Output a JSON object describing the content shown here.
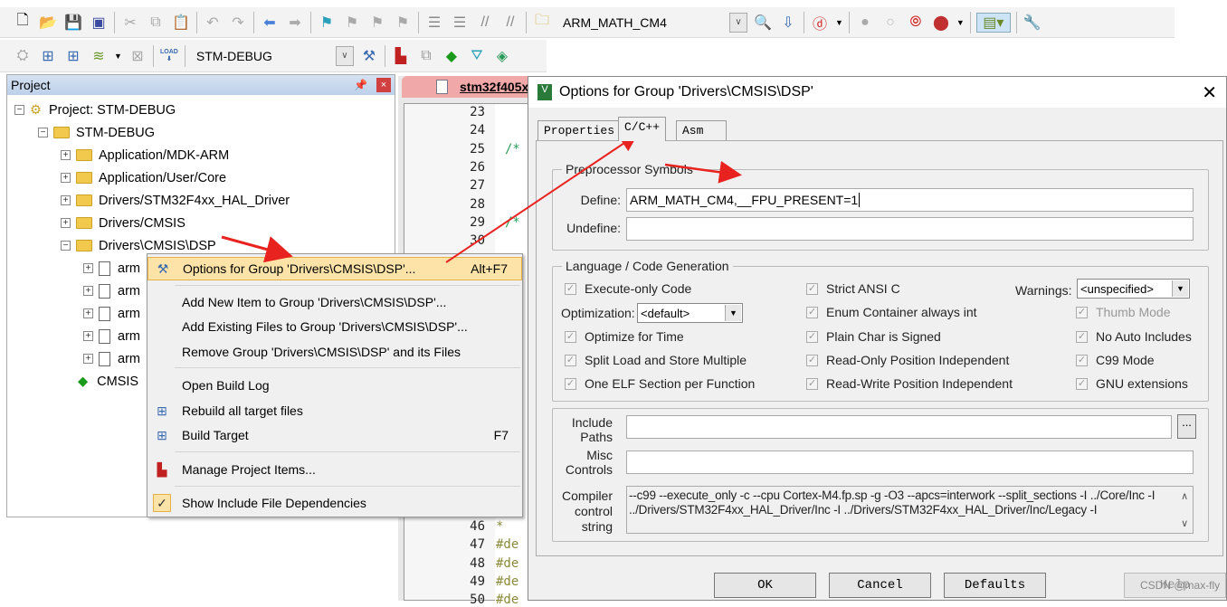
{
  "toolbar1": {
    "target_combo": "ARM_MATH_CM4"
  },
  "toolbar2": {
    "target_combo": "STM-DEBUG",
    "load_label": "LOAD"
  },
  "project_panel": {
    "title": "Project",
    "tree": [
      {
        "label": "Project: STM-DEBUG"
      },
      {
        "label": "STM-DEBUG"
      },
      {
        "label": "Application/MDK-ARM"
      },
      {
        "label": "Application/User/Core"
      },
      {
        "label": "Drivers/STM32F4xx_HAL_Driver"
      },
      {
        "label": "Drivers/CMSIS"
      },
      {
        "label": "Drivers\\CMSIS\\DSP"
      },
      {
        "label": "arm"
      },
      {
        "label": "arm"
      },
      {
        "label": "arm"
      },
      {
        "label": "arm"
      },
      {
        "label": "arm"
      },
      {
        "label": "CMSIS"
      }
    ]
  },
  "editor": {
    "tab": "stm32f405x",
    "lines_top": [
      "23",
      "24",
      "25",
      "26",
      "27",
      "28",
      "29",
      "30"
    ],
    "lines_bottom": [
      "46",
      "47",
      "48",
      "49",
      "50"
    ],
    "code_bottom": [
      "*",
      "#de",
      "#de",
      "#de",
      "#de"
    ],
    "code_top": {
      "25": "/*",
      "29": "/*"
    }
  },
  "context_menu": {
    "items": [
      {
        "label": "Options for Group 'Drivers\\CMSIS\\DSP'...",
        "shortcut": "Alt+F7"
      },
      {
        "label": "Add New  Item to Group 'Drivers\\CMSIS\\DSP'..."
      },
      {
        "label": "Add Existing Files to Group 'Drivers\\CMSIS\\DSP'..."
      },
      {
        "label": "Remove Group 'Drivers\\CMSIS\\DSP' and its Files"
      },
      {
        "label": "Open Build Log"
      },
      {
        "label": "Rebuild all target files"
      },
      {
        "label": "Build Target",
        "shortcut": "F7"
      },
      {
        "label": "Manage Project Items..."
      },
      {
        "label": "Show Include File Dependencies",
        "checked": true
      }
    ]
  },
  "dialog": {
    "title": "Options for Group 'Drivers\\CMSIS\\DSP'",
    "tabs": [
      "Properties",
      "C/C++",
      "Asm"
    ],
    "active_tab": "C/C++",
    "preprocessor": {
      "legend": "Preprocessor Symbols",
      "define_label": "Define:",
      "define_value": "ARM_MATH_CM4,__FPU_PRESENT=1",
      "undefine_label": "Undefine:",
      "undefine_value": ""
    },
    "language": {
      "legend": "Language / Code Generation",
      "col1": [
        "Execute-only Code",
        "Optimize for Time",
        "Split Load and Store Multiple",
        "One ELF Section per Function"
      ],
      "optimization_label": "Optimization:",
      "optimization_value": "<default>",
      "col2": [
        "Strict ANSI C",
        "Enum Container always int",
        "Plain Char is Signed",
        "Read-Only Position Independent",
        "Read-Write Position Independent"
      ],
      "warnings_label": "Warnings:",
      "warnings_value": "<unspecified>",
      "col3": [
        "Thumb Mode",
        "No Auto Includes",
        "C99 Mode",
        "GNU extensions"
      ]
    },
    "include_paths_label": "Include\nPaths",
    "include_paths_value": "",
    "browse_label": "...",
    "misc_label": "Misc\nControls",
    "misc_value": "",
    "compiler_label": "Compiler\ncontrol\nstring",
    "compiler_value": "--c99 --execute_only -c --cpu Cortex-M4.fp.sp -g -O3 --apcs=interwork --split_sections -I ../Core/Inc -I ../Drivers/STM32F4xx_HAL_Driver/Inc -I ../Drivers/STM32F4xx_HAL_Driver/Inc/Legacy -I",
    "buttons": {
      "ok": "OK",
      "cancel": "Cancel",
      "defaults": "Defaults",
      "help": "Help"
    }
  },
  "watermark": "CSDN @max-fly",
  "colors": {
    "annotation_arrow": "#e8231f",
    "menu_highlight": "#fde3a7",
    "panel_header": "#c8d8ee"
  }
}
